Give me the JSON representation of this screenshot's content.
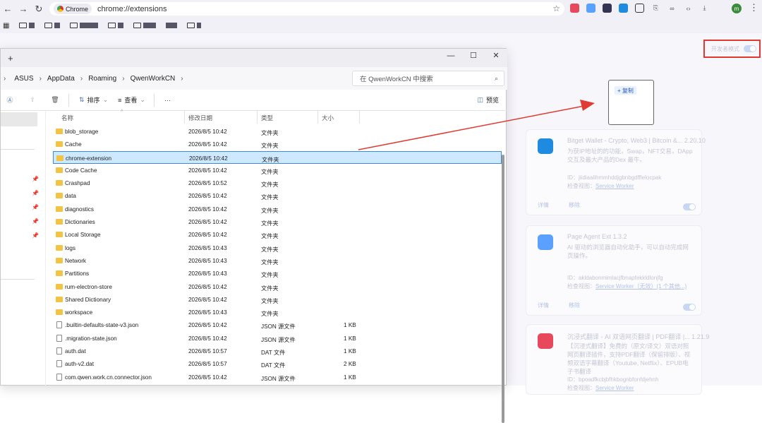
{
  "browser": {
    "chip_label": "Chrome",
    "url": "chrome://extensions",
    "avatar_letter": "m"
  },
  "ext_page": {
    "dev_mode_label": "开发者模式",
    "copy_label": "+ 复制",
    "cards": [
      {
        "name": "Bitget Wallet - Crypto, Web3 | Bitcoin &...   2.20.10",
        "desc": "为获IP地址的的功能，Swap，NFT交易，DApp交互及最大产品的Dex 最牛。",
        "id": "ID：jiidiaalihmmhddjgbnbgdfflelocpak",
        "view_label": "检查视图：",
        "view_link": "Service Worker",
        "details": "详情",
        "remove": "移除",
        "color": "#1f8be0"
      },
      {
        "name": "Page Agent Ext   1.3.2",
        "desc": "AI 驱动的浏览器自动化助手，可以自动完成网页操作。",
        "id": "ID：akldabonmimlacjfbnapfekkldlonjfg",
        "view_label": "检查视图：",
        "view_link": "Service Worker（无效）(1 个其他...)",
        "details": "详情",
        "remove": "移除",
        "color": "#5aa0ff"
      },
      {
        "name": "沉浸式翻译 - AI 双语网页翻译 | PDF翻译 |...   1.21.9",
        "desc": "【沉浸式翻译】免费的（原文/译文）双语对照网页翻译插件，支持PDF翻译（保留排版）、视频双语字幕翻译（Youtube, Netflix）、EPUB电子书翻译",
        "id": "ID：bpoadfkcbjbfhkbognbfonfdjehnh",
        "view_label": "检查视图：",
        "view_link": "Service Worker",
        "details": "详情",
        "remove": "移除",
        "color": "#e8485c"
      }
    ]
  },
  "explorer": {
    "new_tab": "+",
    "breadcrumb": [
      "ASUS",
      "AppData",
      "Roaming",
      "QwenWorkCN"
    ],
    "search_placeholder": "在 QwenWorkCN 中搜索",
    "toolbar": {
      "sort": "排序",
      "view": "查看",
      "more": "···",
      "preview": "预览"
    },
    "columns": [
      "名称",
      "修改日期",
      "类型",
      "大小"
    ],
    "rows": [
      {
        "name": "blob_storage",
        "date": "2026/8/5 10:42",
        "type": "文件夹",
        "size": "",
        "kind": "folder"
      },
      {
        "name": "Cache",
        "date": "2026/8/5 10:42",
        "type": "文件夹",
        "size": "",
        "kind": "folder"
      },
      {
        "name": "chrome-extension",
        "date": "2026/8/5 10:42",
        "type": "文件夹",
        "size": "",
        "kind": "folder"
      },
      {
        "name": "Code Cache",
        "date": "2026/8/5 10:42",
        "type": "文件夹",
        "size": "",
        "kind": "folder"
      },
      {
        "name": "Crashpad",
        "date": "2026/8/5 10:52",
        "type": "文件夹",
        "size": "",
        "kind": "folder"
      },
      {
        "name": "data",
        "date": "2026/8/5 10:42",
        "type": "文件夹",
        "size": "",
        "kind": "folder"
      },
      {
        "name": "diagnostics",
        "date": "2026/8/5 10:42",
        "type": "文件夹",
        "size": "",
        "kind": "folder"
      },
      {
        "name": "Dictionaries",
        "date": "2026/8/5 10:42",
        "type": "文件夹",
        "size": "",
        "kind": "folder"
      },
      {
        "name": "Local Storage",
        "date": "2026/8/5 10:42",
        "type": "文件夹",
        "size": "",
        "kind": "folder"
      },
      {
        "name": "logs",
        "date": "2026/8/5 10:43",
        "type": "文件夹",
        "size": "",
        "kind": "folder"
      },
      {
        "name": "Network",
        "date": "2026/8/5 10:43",
        "type": "文件夹",
        "size": "",
        "kind": "folder"
      },
      {
        "name": "Partitions",
        "date": "2026/8/5 10:43",
        "type": "文件夹",
        "size": "",
        "kind": "folder"
      },
      {
        "name": "rum-electron-store",
        "date": "2026/8/5 10:42",
        "type": "文件夹",
        "size": "",
        "kind": "folder"
      },
      {
        "name": "Shared Dictionary",
        "date": "2026/8/5 10:42",
        "type": "文件夹",
        "size": "",
        "kind": "folder"
      },
      {
        "name": "workspace",
        "date": "2026/8/5 10:43",
        "type": "文件夹",
        "size": "",
        "kind": "folder"
      },
      {
        "name": ".builtin-defaults-state-v3.json",
        "date": "2026/8/5 10:42",
        "type": "JSON 源文件",
        "size": "1 KB",
        "kind": "file"
      },
      {
        "name": ".migration-state.json",
        "date": "2026/8/5 10:42",
        "type": "JSON 源文件",
        "size": "1 KB",
        "kind": "file"
      },
      {
        "name": "auth.dat",
        "date": "2026/8/5 10:57",
        "type": "DAT 文件",
        "size": "1 KB",
        "kind": "file"
      },
      {
        "name": "auth-v2.dat",
        "date": "2026/8/5 10:57",
        "type": "DAT 文件",
        "size": "2 KB",
        "kind": "file"
      },
      {
        "name": "com.qwen.work.cn.connector.json",
        "date": "2026/8/5 10:42",
        "type": "JSON 源文件",
        "size": "1 KB",
        "kind": "file"
      }
    ],
    "selected_row": "chrome-extension"
  }
}
